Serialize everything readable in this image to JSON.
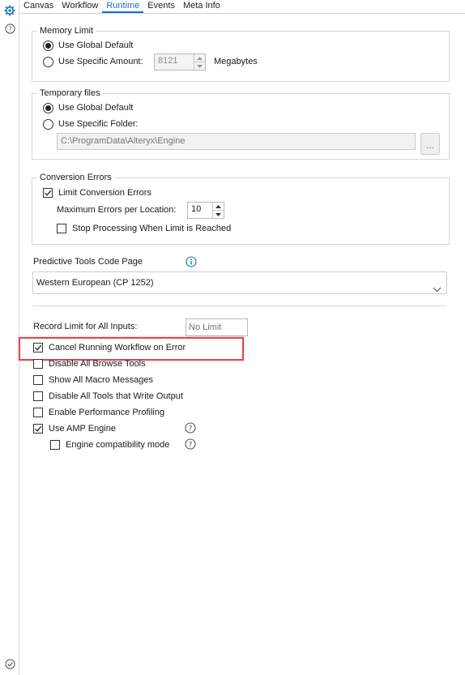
{
  "tabs": [
    "Canvas",
    "Workflow",
    "Runtime",
    "Events",
    "Meta Info"
  ],
  "active_tab": "Runtime",
  "memory_limit": {
    "title": "Memory Limit",
    "global_label": "Use Global Default",
    "specific_label": "Use Specific Amount:",
    "amount_value": "8121",
    "unit_label": "Megabytes"
  },
  "temp_files": {
    "title": "Temporary files",
    "global_label": "Use Global Default",
    "specific_label": "Use Specific Folder:",
    "folder_path": "C:\\ProgramData\\Alteryx\\Engine",
    "browse_label": "..."
  },
  "conversion_errors": {
    "title": "Conversion Errors",
    "limit_label": "Limit Conversion Errors",
    "max_label": "Maximum Errors per Location:",
    "max_value": "10",
    "stop_label": "Stop Processing When Limit is Reached"
  },
  "predictive": {
    "label": "Predictive Tools Code Page",
    "value": "Western European (CP 1252)"
  },
  "record_limit": {
    "label": "Record Limit for All Inputs:",
    "placeholder": "No Limit"
  },
  "options": {
    "cancel_on_error": "Cancel Running Workflow on Error",
    "disable_browse": "Disable All Browse Tools",
    "show_macro": "Show All Macro Messages",
    "disable_output": "Disable All Tools that Write Output",
    "perf_profiling": "Enable Performance Profiling",
    "amp_engine": "Use AMP Engine",
    "engine_compat": "Engine compatibility mode"
  },
  "colors": {
    "accent": "#1a6fc7",
    "highlight": "#e0474c"
  }
}
